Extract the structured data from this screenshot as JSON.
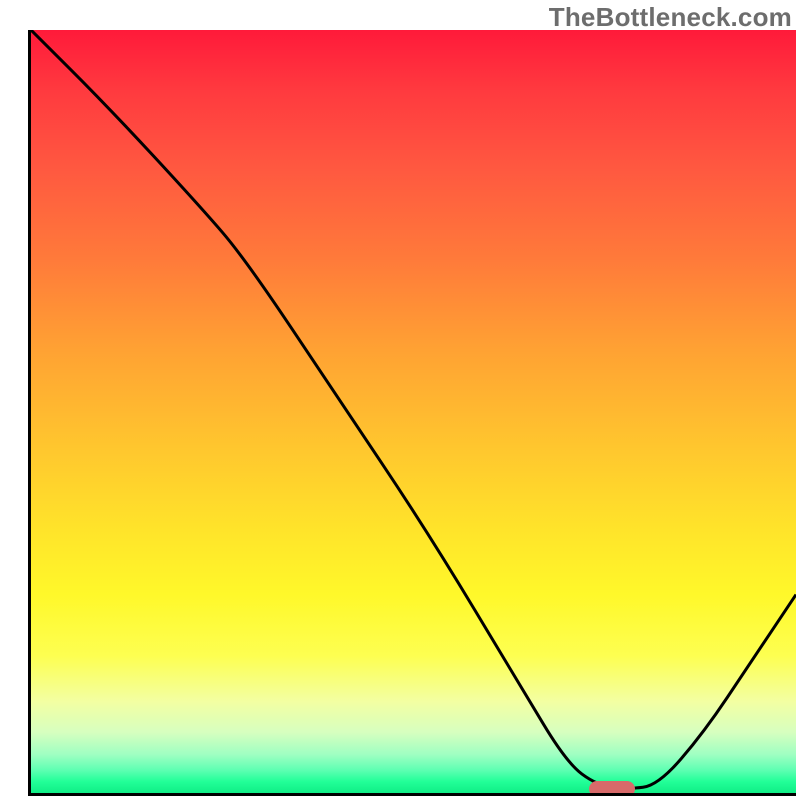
{
  "watermark": "TheBottleneck.com",
  "colors": {
    "curve": "#000000",
    "marker": "#d86a6a",
    "axis": "#000000"
  },
  "chart_data": {
    "type": "line",
    "title": "",
    "xlabel": "",
    "ylabel": "",
    "xlim": [
      0,
      100
    ],
    "ylim": [
      0,
      100
    ],
    "grid": false,
    "legend": false,
    "series": [
      {
        "name": "bottleneck-curve",
        "x": [
          0,
          10,
          22,
          28,
          40,
          52,
          64,
          70,
          74,
          78,
          82,
          88,
          94,
          100
        ],
        "y": [
          100,
          90,
          77,
          70,
          52,
          34,
          14,
          4,
          1,
          0.5,
          1,
          8,
          17,
          26
        ]
      }
    ],
    "marker": {
      "x": 76,
      "y": 0.5
    },
    "background_gradient_stops": [
      {
        "pos": 0,
        "color": "#ff1a3a"
      },
      {
        "pos": 50,
        "color": "#ffc72e"
      },
      {
        "pos": 82,
        "color": "#fdff51"
      },
      {
        "pos": 100,
        "color": "#10ee86"
      }
    ]
  }
}
